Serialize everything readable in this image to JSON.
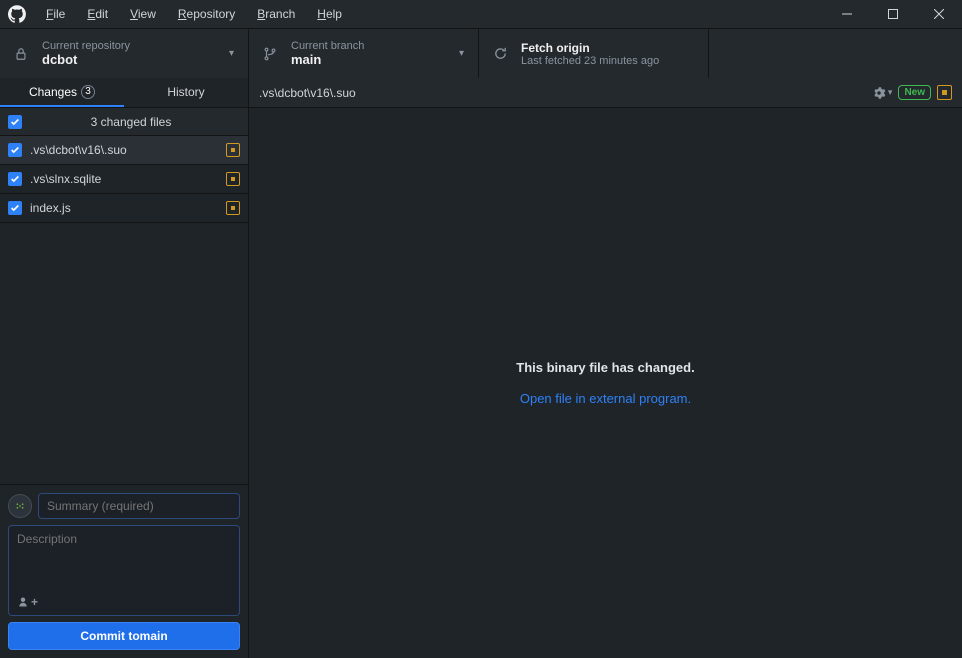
{
  "menu": [
    "File",
    "Edit",
    "View",
    "Repository",
    "Branch",
    "Help"
  ],
  "toolbar": {
    "repo_label": "Current repository",
    "repo_value": "dcbot",
    "branch_label": "Current branch",
    "branch_value": "main",
    "fetch_label": "Fetch origin",
    "fetch_status": "Last fetched 23 minutes ago"
  },
  "tabs": {
    "changes": "Changes",
    "changes_count": "3",
    "history": "History"
  },
  "files": {
    "header": "3 changed files",
    "items": [
      {
        "name": ".vs\\dcbot\\v16\\.suo",
        "selected": true
      },
      {
        "name": ".vs\\slnx.sqlite",
        "selected": false
      },
      {
        "name": "index.js",
        "selected": false
      }
    ]
  },
  "commit": {
    "summary_placeholder": "Summary (required)",
    "description_placeholder": "Description",
    "button_prefix": "Commit to ",
    "button_branch": "main"
  },
  "diff": {
    "path": ".vs\\dcbot\\v16\\.suo",
    "new_pill": "New",
    "binary_message": "This binary file has changed.",
    "open_external": "Open file in external program."
  }
}
